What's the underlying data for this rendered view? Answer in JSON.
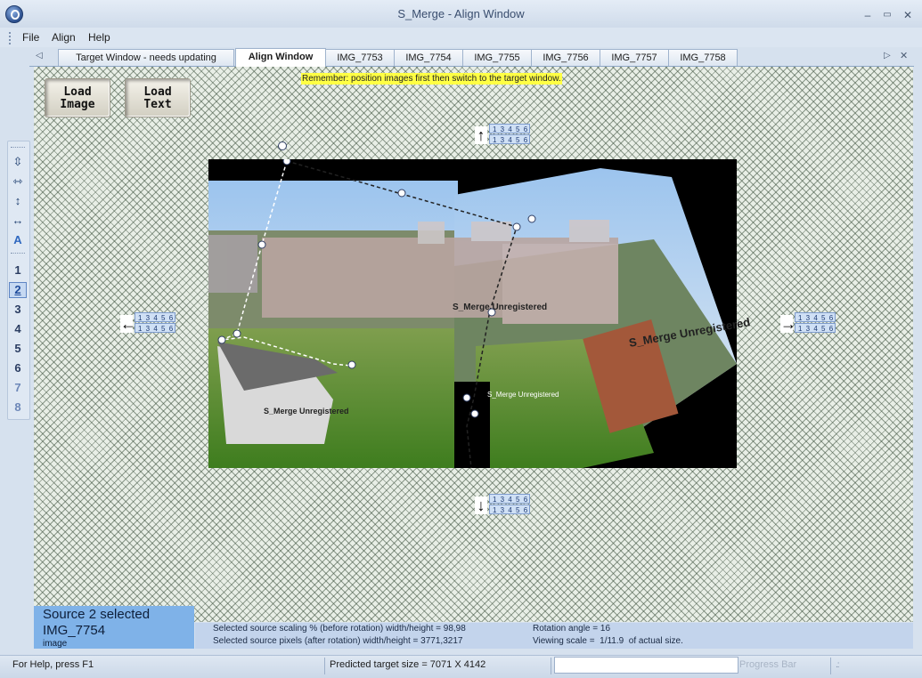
{
  "window": {
    "title": "S_Merge - Align Window",
    "minimize": "–",
    "maximize": "▭",
    "close": "✕"
  },
  "menu": {
    "items": [
      "File",
      "Align",
      "Help"
    ]
  },
  "tabs": {
    "items": [
      {
        "label": "Target Window - needs updating",
        "active": false
      },
      {
        "label": "Align Window",
        "active": true
      },
      {
        "label": "IMG_7753",
        "active": false
      },
      {
        "label": "IMG_7754",
        "active": false
      },
      {
        "label": "IMG_7755",
        "active": false
      },
      {
        "label": "IMG_7756",
        "active": false
      },
      {
        "label": "IMG_7757",
        "active": false
      },
      {
        "label": "IMG_7758",
        "active": false
      }
    ],
    "nav_left": "◁",
    "nav_right": "▷",
    "close": "✕"
  },
  "toolbar": {
    "tools": [
      {
        "icon": "center-horizontal-icon",
        "glyph": "⇳"
      },
      {
        "icon": "center-vertical-icon",
        "glyph": "⇿"
      },
      {
        "icon": "fit-height-icon",
        "glyph": "↕"
      },
      {
        "icon": "fit-width-icon",
        "glyph": "↔"
      },
      {
        "icon": "text-icon",
        "glyph": "A"
      }
    ],
    "sources": [
      "1",
      "2",
      "3",
      "4",
      "5",
      "6",
      "7",
      "8"
    ],
    "selected_source": "2"
  },
  "canvas": {
    "load_image": "Load\nImage",
    "load_text": "Load\nText",
    "reminder": "Remember: position images first then switch to the target window.",
    "nudge_digits": "1 3 4 5 6",
    "arrows": {
      "up": "↑",
      "down": "↓",
      "left": "←",
      "right": "→"
    },
    "watermark": "S_Merge Unregistered"
  },
  "info": {
    "source_selected": "Source 2 selected",
    "source_name": "IMG_7754",
    "source_type": "image",
    "scaling": "Selected source scaling % (before rotation) width/height = 98,98",
    "pixels": "Selected source pixels (after rotation) width/height = 3771,3217",
    "rotation": "Rotation angle = 16",
    "viewing_scale": "Viewing scale =  1/11.9  of actual size."
  },
  "status": {
    "help": "For Help, press F1",
    "predicted": "Predicted target size = 7071 X 4142",
    "progress_label": "Progress Bar",
    "progress_value": 0
  }
}
